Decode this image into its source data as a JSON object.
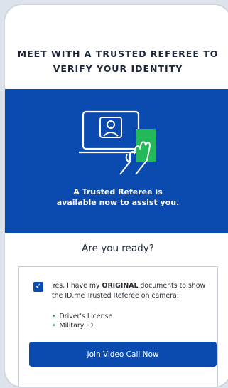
{
  "headline": "MEET WITH A TRUSTED REFEREE TO VERIFY YOUR IDENTITY",
  "hero": {
    "illustration_icon": "video-call-illustration",
    "message": "A Trusted Referee is available now to assist you."
  },
  "prompt": "Are you ready?",
  "consent": {
    "checked": true,
    "text_before": "Yes, I have my ",
    "text_emphasis": "ORIGINAL",
    "text_after": " documents to show the ID.me Trusted Referee on camera:"
  },
  "documents": [
    "Driver's License",
    "Military ID"
  ],
  "cta": {
    "label": "Join Video Call Now"
  },
  "colors": {
    "brand_blue": "#0b4bb0",
    "bullet_green": "#1fae55",
    "card_green": "#23b85a"
  }
}
